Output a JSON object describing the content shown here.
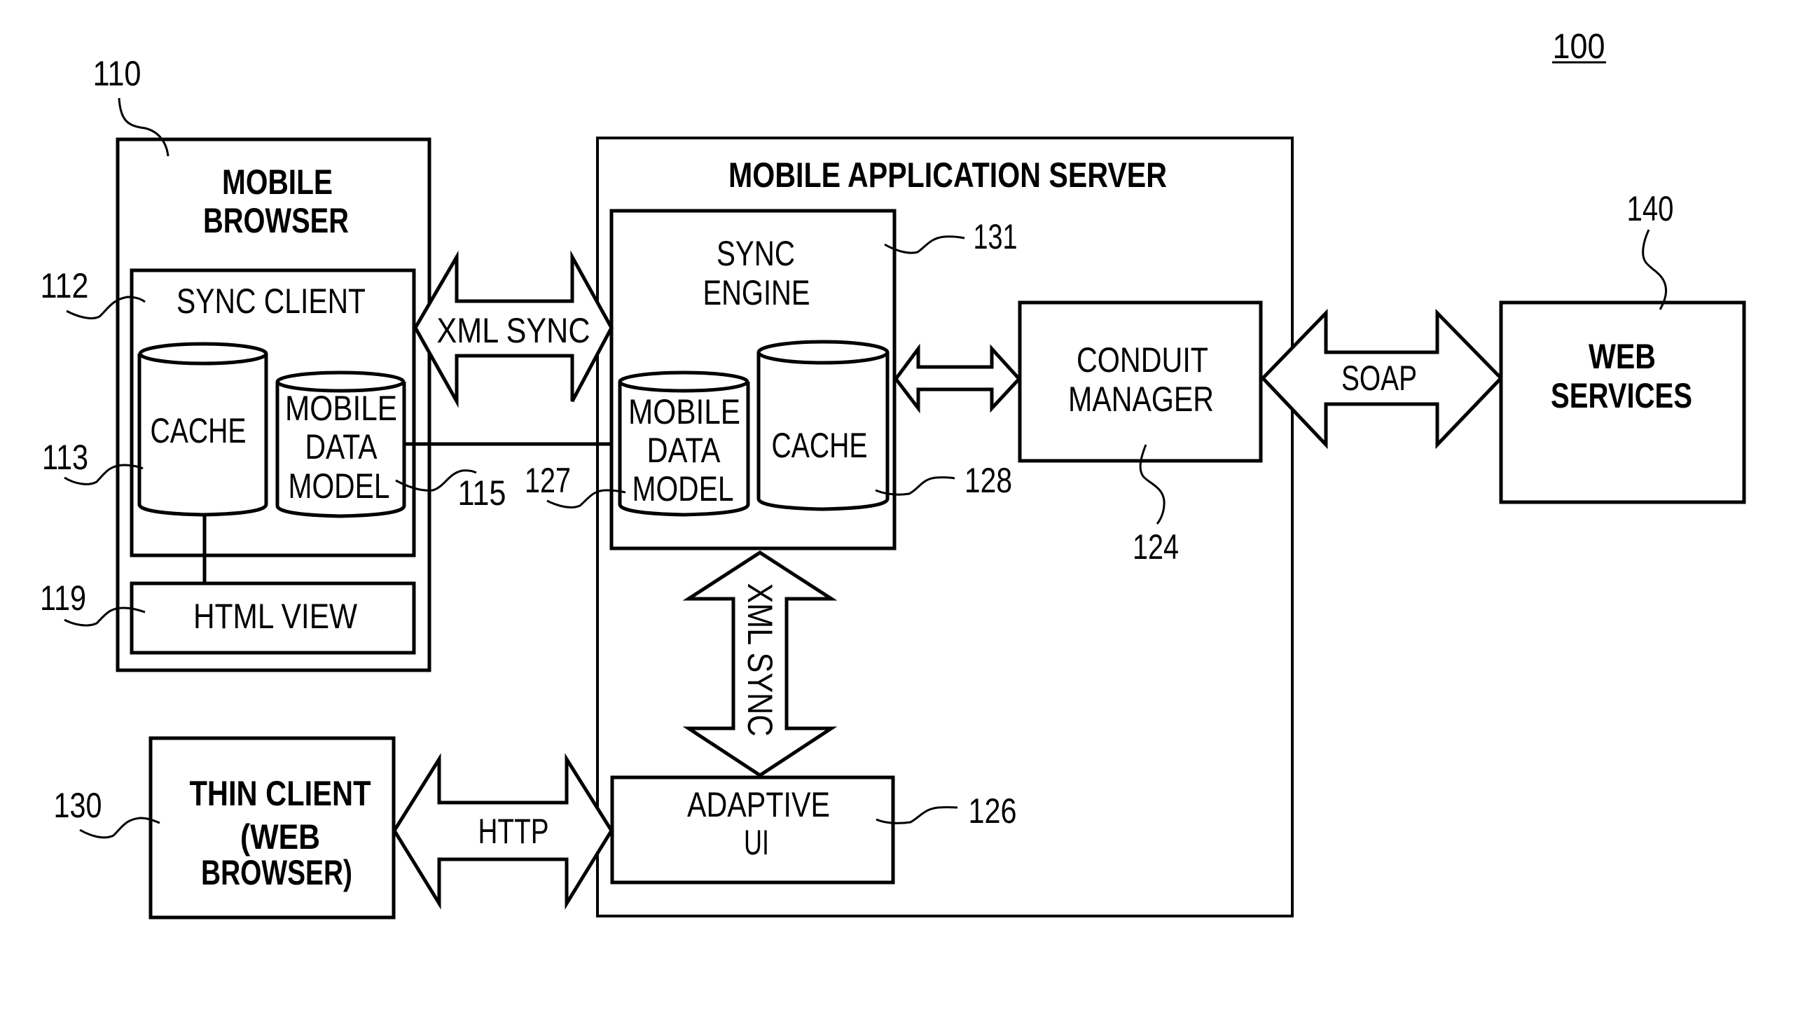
{
  "figure": {
    "figure_number": "100",
    "colors": {
      "stroke": "#000000",
      "background": "#ffffff"
    }
  },
  "mobile_browser": {
    "ref": "110",
    "title_line1": "MOBILE",
    "title_line2": "BROWSER",
    "sync_client": {
      "ref": "112",
      "label": "SYNC CLIENT",
      "cache": {
        "ref": "113",
        "label": "CACHE"
      },
      "mobile_data_model": {
        "ref": "115",
        "line1": "MOBILE",
        "line2": "DATA",
        "line3": "MODEL"
      }
    },
    "html_view": {
      "ref": "119",
      "label": "HTML VIEW"
    }
  },
  "mobile_application_server": {
    "title": "MOBILE APPLICATION SERVER",
    "sync_engine": {
      "ref": "131",
      "line1": "SYNC",
      "line2": "ENGINE",
      "mobile_data_model": {
        "ref": "127",
        "line1": "MOBILE",
        "line2": "DATA",
        "line3": "MODEL"
      },
      "cache": {
        "ref": "128",
        "label": "CACHE"
      }
    },
    "conduit_manager": {
      "ref": "124",
      "line1": "CONDUIT",
      "line2": "MANAGER"
    },
    "adaptive_ui": {
      "ref": "126",
      "line1": "ADAPTIVE",
      "line2": "UI"
    }
  },
  "thin_client": {
    "ref": "130",
    "line1": "THIN CLIENT",
    "line2": "(WEB",
    "line3": "BROWSER)"
  },
  "web_services": {
    "ref": "140",
    "line1": "WEB",
    "line2": "SERVICES"
  },
  "connections": {
    "client_server_sync": "XML SYNC",
    "engine_adaptive_sync": "XML SYNC",
    "thin_client_http": "HTTP",
    "web_services_soap": "SOAP"
  }
}
